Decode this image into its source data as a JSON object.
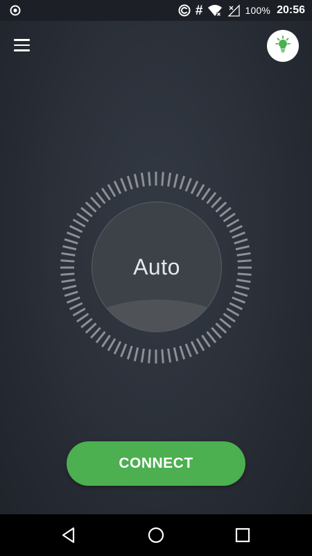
{
  "status_bar": {
    "icons": [
      "record-icon",
      "data-saver-icon",
      "hash-icon",
      "wifi-icon",
      "signal-off-icon"
    ],
    "hash_glyph": "#",
    "battery": "100%",
    "time": "20:56"
  },
  "toolbar": {
    "menu_icon": "hamburger-menu-icon",
    "tips_icon": "lightbulb-icon"
  },
  "server": {
    "label": "Auto"
  },
  "connect": {
    "label": "CONNECT"
  },
  "nav_bar": {
    "icons": [
      "back-icon",
      "home-icon",
      "recents-icon"
    ]
  },
  "colors": {
    "accent": "#4caf50",
    "background": "#2b3039",
    "status_bar": "#1c1f25",
    "nav_bar": "#000000"
  }
}
